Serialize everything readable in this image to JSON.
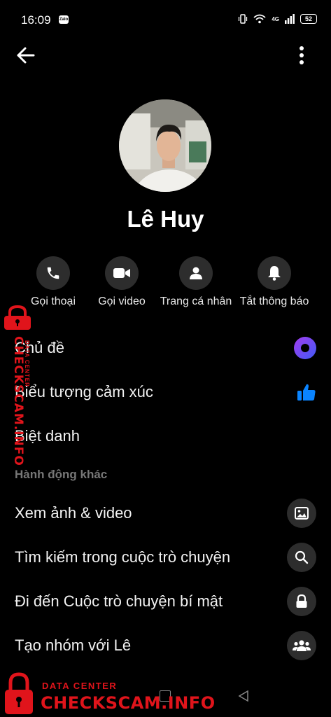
{
  "status_bar": {
    "time": "16:09",
    "zalo_badge": "Zalo",
    "network": "4G",
    "battery": "52"
  },
  "profile": {
    "name": "Lê Huy"
  },
  "actions": [
    {
      "label": "Gọi thoại",
      "icon": "phone-icon"
    },
    {
      "label": "Gọi video",
      "icon": "video-camera-icon"
    },
    {
      "label": "Trang cá nhân",
      "icon": "person-icon"
    },
    {
      "label": "Tắt thông báo",
      "icon": "bell-icon"
    }
  ],
  "settings": [
    {
      "label": "Chủ đề",
      "icon": "theme-circle-icon"
    },
    {
      "label": "Biểu tượng cảm xúc",
      "icon": "thumbs-up-icon"
    },
    {
      "label": "Biệt danh"
    }
  ],
  "section_title": "Hành động khác",
  "more_actions": [
    {
      "label": "Xem ảnh & video",
      "icon": "image-icon"
    },
    {
      "label": "Tìm kiếm trong cuộc trò chuyện",
      "icon": "search-icon"
    },
    {
      "label": "Đi đến Cuộc trò chuyện bí mật",
      "icon": "lock-icon"
    },
    {
      "label": "Tạo nhóm với Lê",
      "icon": "group-icon"
    }
  ],
  "watermark": {
    "line1": "DATA CENTER",
    "line2": "CHECKSCAM.INFO"
  },
  "colors": {
    "background": "#000000",
    "button_bg": "#2d2d2d",
    "accent_blue": "#0a84ff",
    "theme_purple": "#6a3cf0",
    "watermark_red": "#e0141b"
  }
}
